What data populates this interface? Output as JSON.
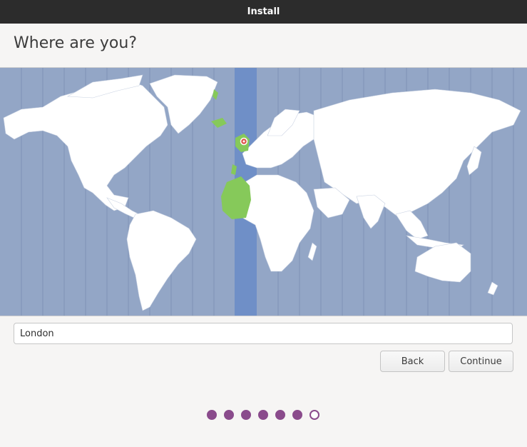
{
  "window": {
    "title": "Install"
  },
  "page": {
    "title": "Where are you?"
  },
  "map": {
    "selected_timezone_city": "London",
    "colors": {
      "ocean": "#93a6c6",
      "land": "#ffffff",
      "selected_zone_band": "#6f8fc7",
      "selected_zone_land": "#86c95a",
      "marker": "#e0534a"
    }
  },
  "location": {
    "value": "London"
  },
  "buttons": {
    "back": "Back",
    "continue": "Continue"
  },
  "progress": {
    "total_steps": 7,
    "completed_steps": 6,
    "accent": "#8a4b8c"
  }
}
